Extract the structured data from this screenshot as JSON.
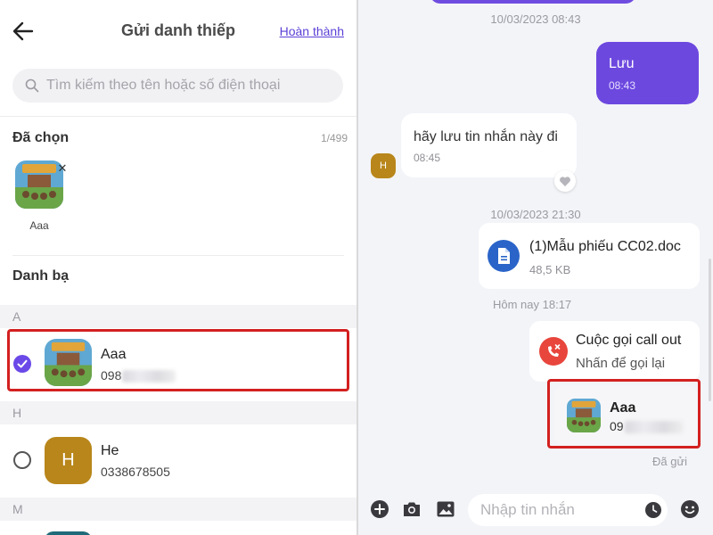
{
  "left_panel": {
    "header": {
      "title": "Gửi danh thiếp",
      "done_label": "Hoàn thành",
      "back_icon": "arrow-left-icon"
    },
    "search": {
      "placeholder": "Tìm kiếm theo tên hoặc số điện thoại",
      "value": ""
    },
    "selected": {
      "title": "Đã chọn",
      "counter": "1/499",
      "items": [
        {
          "name": "Aaa",
          "remove_icon": "close-icon"
        }
      ]
    },
    "contacts": {
      "title": "Danh bạ",
      "groups": [
        {
          "letter": "A",
          "items": [
            {
              "name": "Aaa",
              "phone_visible": "098",
              "phone_obscured": true,
              "checked": true
            }
          ]
        },
        {
          "letter": "H",
          "items": [
            {
              "name": "He",
              "avatar_letter": "H",
              "phone_visible": "0338678505",
              "checked": false
            }
          ]
        },
        {
          "letter": "M",
          "items": []
        }
      ]
    }
  },
  "right_panel": {
    "messages": [
      {
        "type": "timestamp",
        "text": "10/03/2023 08:43"
      },
      {
        "type": "outgoing",
        "text": "Lưu",
        "time": "08:43"
      },
      {
        "type": "incoming",
        "text": "hãy lưu tin nhắn này đi",
        "time": "08:45",
        "avatar_letter": "H",
        "reaction_icon": "heart-icon"
      },
      {
        "type": "timestamp",
        "text": "10/03/2023 21:30"
      },
      {
        "type": "file",
        "name": "(1)Mẫu phiếu CC02.doc",
        "size": "48,5 KB",
        "icon": "document-icon"
      },
      {
        "type": "timestamp",
        "text": "Hôm nay 18:17"
      },
      {
        "type": "call",
        "title": "Cuộc gọi call out",
        "subtitle": "Nhấn để gọi lại",
        "icon": "missed-call-icon"
      },
      {
        "type": "contact_card",
        "name": "Aaa",
        "phone_visible": "09",
        "phone_obscured": true
      },
      {
        "type": "status",
        "text": "Đã gửi"
      }
    ],
    "composer": {
      "placeholder": "Nhập tin nhắn",
      "value": "",
      "icons": [
        "plus-icon",
        "camera-icon",
        "image-icon",
        "clock-icon",
        "emoji-icon"
      ]
    }
  },
  "colors": {
    "accent": "#6d48df",
    "highlight_border": "#d32020",
    "avatar_h": "#b8861a",
    "file_icon": "#2a64c8",
    "call_icon": "#e8453c"
  }
}
